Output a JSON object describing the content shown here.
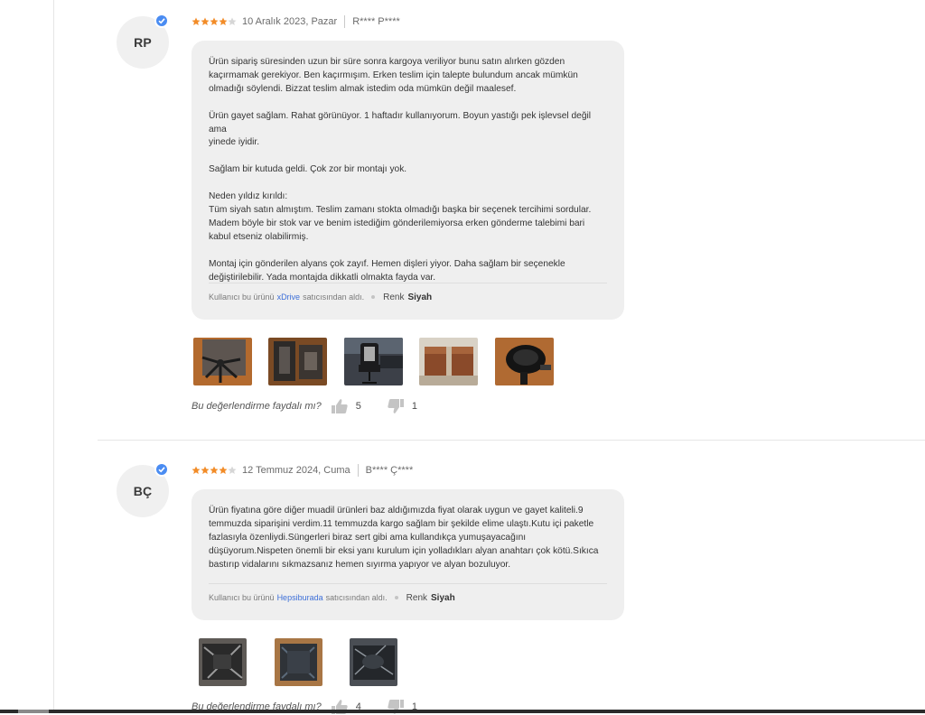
{
  "reviews": [
    {
      "initials": "RP",
      "rating": 4,
      "date": "10 Aralık 2023, Pazar",
      "author": "R**** P****",
      "body": "Ürün sipariş süresinden uzun bir süre sonra kargoya veriliyor bunu satın alırken gözden\nkaçırmamak gerekiyor. Ben kaçırmışım. Erken teslim için talepte bulundum ancak mümkün\nolmadığı söylendi. Bizzat teslim almak istedim oda mümkün değil maalesef.\n\nÜrün gayet sağlam. Rahat görünüyor. 1 haftadır kullanıyorum. Boyun yastığı pek işlevsel değil ama\nyinede iyidir.\n\nSağlam bir kutuda geldi. Çok zor bir montajı yok.\n\nNeden yıldız kırıldı:\nTüm siyah satın almıştım. Teslim zamanı stokta olmadığı başka bir seçenek tercihimi sordular.\nMadem böyle bir stok var ve benim istediğim gönderilemiyorsa erken gönderme talebimi bari\nkabul etseniz olabilirmiş.\n\nMontaj için gönderilen alyans çok zayıf. Hemen dişleri yiyor. Daha sağlam bir seçenekle\ndeğiştirilebilir. Yada montajda dikkatli olmakta fayda var.",
      "purchase_prefix": "Kullanıcı bu ürünü",
      "seller": "xDrive",
      "purchase_suffix": "satıcısından aldı.",
      "color_label": "Renk",
      "color_value": "Siyah",
      "photos": [
        "chair-base-photo",
        "chair-parts-photo",
        "assembled-chair-photo",
        "shipping-box-photo",
        "chair-seat-photo"
      ],
      "helpful_question": "Bu değerlendirme faydalı mı?",
      "likes": "5",
      "dislikes": "1"
    },
    {
      "initials": "BÇ",
      "rating": 4,
      "date": "12 Temmuz 2024, Cuma",
      "author": "B**** Ç****",
      "body": "Ürün fiyatına göre diğer muadil ürünleri baz aldığımızda fiyat olarak uygun ve gayet kaliteli.9\ntemmuzda siparişini verdim.11 temmuzda kargo sağlam bir şekilde elime ulaştı.Kutu içi paketle\nfazlasıyla özenliydi.Süngerleri biraz sert gibi ama kullandıkça yumuşayacağını\ndüşüyorum.Nispeten önemli bir eksi yanı kurulum için yolladıkları alyan anahtarı çok kötü.Sıkıca\nbastırıp vidalarını sıkmazsanız hemen sıyırma yapıyor ve alyan bozuluyor.",
      "purchase_prefix": "Kullanıcı bu ürünü",
      "seller": "Hepsiburada",
      "purchase_suffix": "satıcısından aldı.",
      "color_label": "Renk",
      "color_value": "Siyah",
      "photos": [
        "unboxing-photo",
        "packed-box-photo",
        "wrapped-parts-photo"
      ],
      "helpful_question": "Bu değerlendirme faydalı mı?",
      "likes": "4",
      "dislikes": "1"
    }
  ],
  "colors": {
    "star": "#f28c28",
    "verified": "#4a8cf2",
    "seller_link": "#3d6fd8",
    "bubble_bg": "#efefef"
  }
}
